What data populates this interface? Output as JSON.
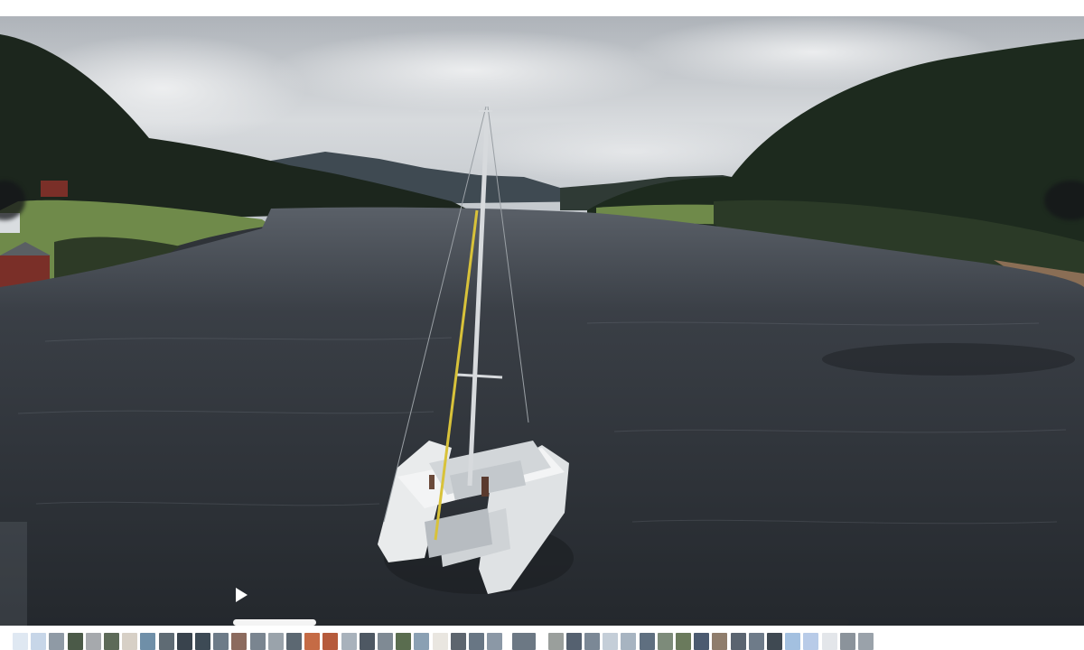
{
  "viewer": {
    "media": "video-frame",
    "icons": {
      "play": "play-icon"
    },
    "playback_progress": 0.135
  },
  "colors": {
    "water": "#2b2f35",
    "sky": "#c9ccd1",
    "hills": "#1f2a1f",
    "boat": "#e9ebec",
    "mast_line": "#d8c23a",
    "scrubber_fill": "#f4f4f4"
  },
  "filmstrip": {
    "thumbnails": [
      "#dfe8f2",
      "#c7d6e8",
      "#8f9aa5",
      "#4b5a48",
      "#a6a9ad",
      "#5d6a58",
      "#d7d0c6",
      "#6f8fa8",
      "#5f6b74",
      "#39434d",
      "#3d4a55",
      "#6d7b88",
      "#8c6b5e",
      "#7a8590",
      "#9aa3ab",
      "#5c6872",
      "#c56b45",
      "#b65b3c",
      "#a8b2bc",
      "#4e5863",
      "#7f8a94",
      "#5a6d4f",
      "#8aa0b3",
      "#e9e6e0",
      "#5d656e",
      "#687684",
      "#8b98a6",
      "#6c7884",
      "#9a9f9c",
      "#556170",
      "#7b8896",
      "#c4ced8",
      "#a7b4c1",
      "#5f6f80",
      "#7d8b7a",
      "#6a7a5c",
      "#4b5a70",
      "#8f7d6c",
      "#5a6470",
      "#6e7b89",
      "#3f4952",
      "#a3c0e0",
      "#b8cbe8",
      "#e3e6ea",
      "#8b939b",
      "#9aa2aa"
    ]
  }
}
